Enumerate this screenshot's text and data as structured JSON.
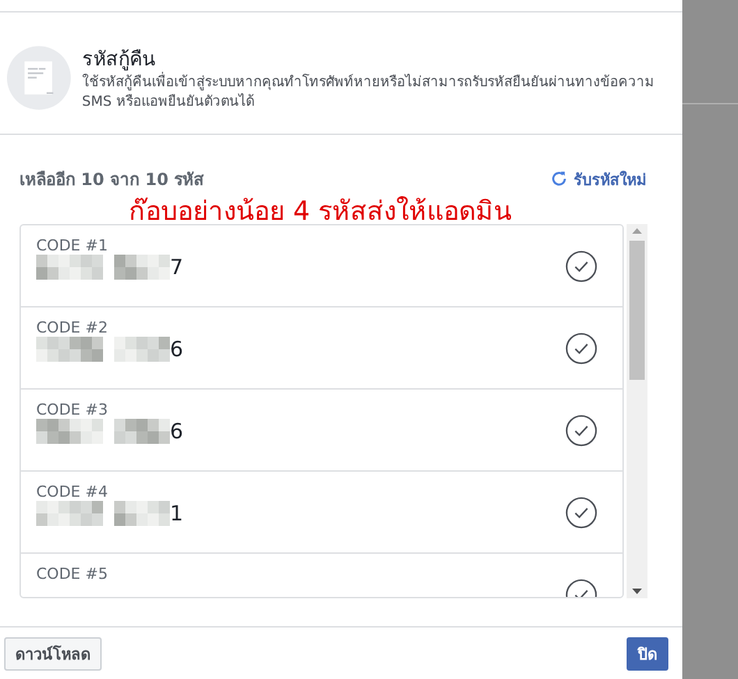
{
  "header": {
    "title": "รหัสกู้คืน",
    "description": "ใช้รหัสกู้คืนเพื่อเข้าสู่ระบบหากคุณทำโทรศัพท์หายหรือไม่สามารถรับรหัสยืนยันผ่านทางข้อความ SMS หรือแอพยืนยันตัวตนได้"
  },
  "remaining": "เหลืออีก 10 จาก 10 รหัส",
  "new_codes_link": "รับรหัสใหม่",
  "annotation": "ก๊อบอย่างน้อย 4 รหัสส่งให้แอดมิน",
  "codes": [
    {
      "label": "CODE #1",
      "shown_digit": "7"
    },
    {
      "label": "CODE #2",
      "shown_digit": "6"
    },
    {
      "label": "CODE #3",
      "shown_digit": "6"
    },
    {
      "label": "CODE #4",
      "shown_digit": "1"
    },
    {
      "label": "CODE #5"
    }
  ],
  "buttons": [
    {
      "label": "ดาวน์โหลด",
      "kind": "secondary"
    },
    {
      "label": "ปิด",
      "kind": "primary"
    }
  ]
}
